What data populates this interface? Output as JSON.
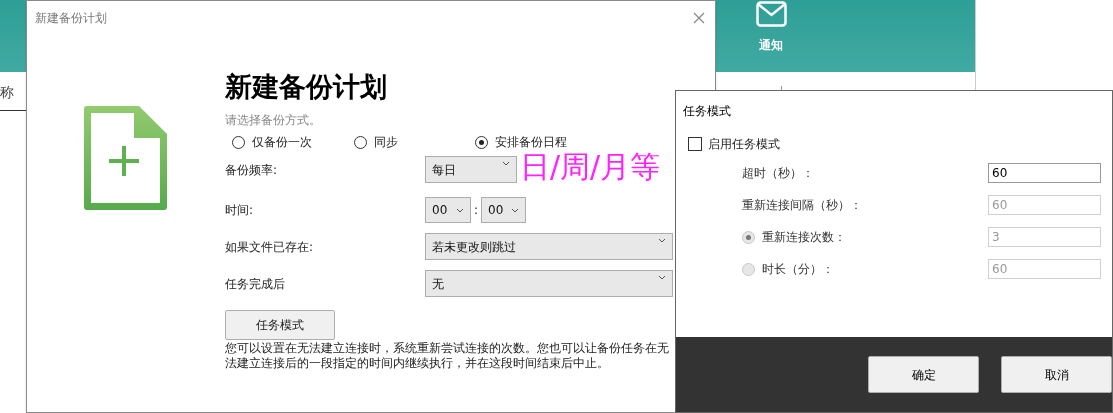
{
  "background_app": {
    "toolbar": [
      {
        "kind": "mail",
        "label": "通知"
      }
    ],
    "columns": [
      "称"
    ]
  },
  "dialog": {
    "title": "新建备份计划",
    "heading": "新建备份计划",
    "subtitle": "请选择备份方式。",
    "modes": [
      {
        "label": "仅备份一次",
        "selected": false
      },
      {
        "label": "同步",
        "selected": false
      },
      {
        "label": "安排备份日程",
        "selected": true
      }
    ],
    "frequency": {
      "label": "备份频率:",
      "value": "每日"
    },
    "annotation": "日/周/月等",
    "time": {
      "label": "时间:",
      "hour": "00",
      "separator": ":",
      "minute": "00"
    },
    "if_exists": {
      "label": "如果文件已存在:",
      "value": "若未更改则跳过"
    },
    "after_task": {
      "label": "任务完成后",
      "value": "无"
    },
    "task_mode_button": "任务模式",
    "description": "您可以设置在无法建立连接时，系统重新尝试连接的次数。您也可以让备份任务在无法建立连接后的一段指定的时间内继续执行，并在这段时间结束后中止。"
  },
  "task_mode_dialog": {
    "title": "任务模式",
    "enable": {
      "label": "启用任务模式",
      "checked": false
    },
    "fields": [
      {
        "kind": "plain",
        "label": "超时（秒）：",
        "value": "60",
        "disabled": false
      },
      {
        "kind": "plain",
        "label": "重新连接间隔（秒）：",
        "value": "60",
        "disabled": true
      },
      {
        "kind": "radio",
        "label": "重新连接次数：",
        "value": "3",
        "disabled": true,
        "selected": true
      },
      {
        "kind": "radio",
        "label": "时长（分）：",
        "value": "60",
        "disabled": true,
        "selected": false
      }
    ],
    "buttons": [
      "确定",
      "取消"
    ]
  }
}
